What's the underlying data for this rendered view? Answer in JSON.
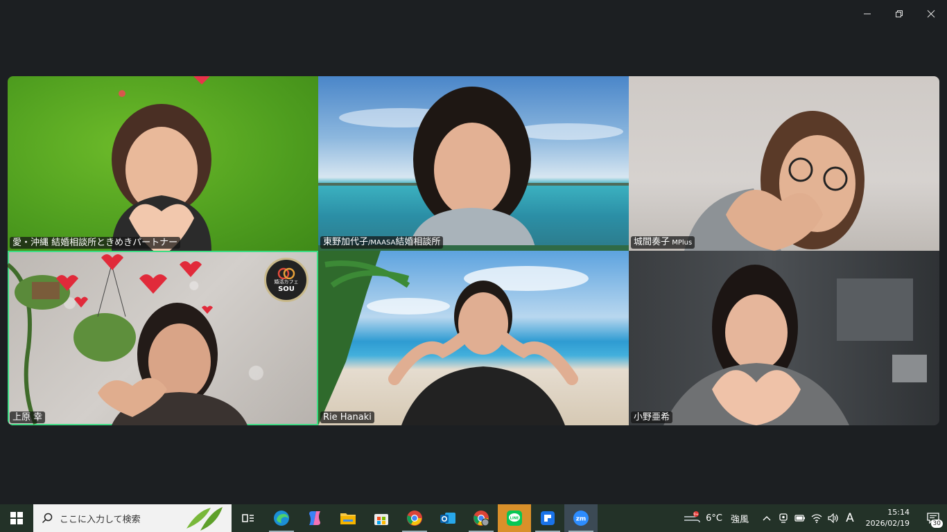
{
  "window": {
    "minimize_icon": "minimize-icon",
    "restore_icon": "restore-icon",
    "close_icon": "close-icon"
  },
  "participants": [
    {
      "name": "愛・沖縄 結婚相談所ときめきパートナー",
      "background": "green-screen-hearts",
      "active": false
    },
    {
      "name_main": "東野加代子",
      "name_small": "/MAASA",
      "name_tail": "結婚相談所",
      "background": "ocean-sky",
      "active": false
    },
    {
      "name_main": "城間奏子",
      "name_small": " MPlus",
      "background": "room",
      "active": false
    },
    {
      "name": "上原 幸",
      "background": "wall-hearts-plants",
      "active": true,
      "logo_top": "婚活カフェ",
      "logo_bottom": "SOU"
    },
    {
      "name": "Rie Hanaki",
      "background": "tropical-beach",
      "active": false
    },
    {
      "name": "小野亜希",
      "background": "office",
      "active": false
    }
  ],
  "taskbar": {
    "search_placeholder": "ここに入力して検索",
    "apps": [
      {
        "icon": "task-view-icon",
        "running": false
      },
      {
        "icon": "edge-icon",
        "running": true
      },
      {
        "icon": "copilot-icon",
        "running": false
      },
      {
        "icon": "file-explorer-icon",
        "running": false
      },
      {
        "icon": "store-icon",
        "running": false
      },
      {
        "icon": "chrome-icon",
        "running": true
      },
      {
        "icon": "outlook-icon",
        "running": false
      },
      {
        "icon": "chrome-profile-icon",
        "running": true
      },
      {
        "icon": "line-icon",
        "running": true,
        "label": "LINE"
      },
      {
        "icon": "app-blue-icon",
        "running": true
      },
      {
        "icon": "zoom-icon",
        "running": true,
        "label": "zm"
      }
    ],
    "weather": {
      "temp": "6°C",
      "condition": "強風",
      "badge": "9+"
    },
    "ime": "A",
    "time": "15:14",
    "date": "2026/02/19",
    "notification_count": "30"
  },
  "colors": {
    "active_speaker_border": "#3ddc84",
    "taskbar_bg": "#233228"
  }
}
